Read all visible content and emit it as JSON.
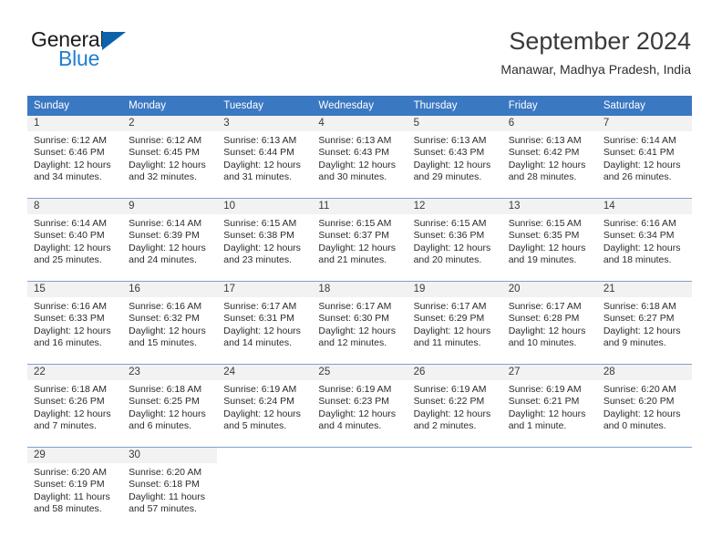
{
  "brand": {
    "name_part1": "General",
    "name_part2": "Blue"
  },
  "header": {
    "title": "September 2024",
    "subtitle": "Manawar, Madhya Pradesh, India"
  },
  "colors": {
    "header_blue": "#3b78c2",
    "brand_blue": "#1f7fd0",
    "triangle_blue": "#0c63ab",
    "daynum_band": "#f2f2f2",
    "row_divider": "#7ba3d0"
  },
  "weekday_headers": [
    "Sunday",
    "Monday",
    "Tuesday",
    "Wednesday",
    "Thursday",
    "Friday",
    "Saturday"
  ],
  "weeks": [
    [
      {
        "day": "1",
        "sunrise": "Sunrise: 6:12 AM",
        "sunset": "Sunset: 6:46 PM",
        "daylight1": "Daylight: 12 hours",
        "daylight2": "and 34 minutes."
      },
      {
        "day": "2",
        "sunrise": "Sunrise: 6:12 AM",
        "sunset": "Sunset: 6:45 PM",
        "daylight1": "Daylight: 12 hours",
        "daylight2": "and 32 minutes."
      },
      {
        "day": "3",
        "sunrise": "Sunrise: 6:13 AM",
        "sunset": "Sunset: 6:44 PM",
        "daylight1": "Daylight: 12 hours",
        "daylight2": "and 31 minutes."
      },
      {
        "day": "4",
        "sunrise": "Sunrise: 6:13 AM",
        "sunset": "Sunset: 6:43 PM",
        "daylight1": "Daylight: 12 hours",
        "daylight2": "and 30 minutes."
      },
      {
        "day": "5",
        "sunrise": "Sunrise: 6:13 AM",
        "sunset": "Sunset: 6:43 PM",
        "daylight1": "Daylight: 12 hours",
        "daylight2": "and 29 minutes."
      },
      {
        "day": "6",
        "sunrise": "Sunrise: 6:13 AM",
        "sunset": "Sunset: 6:42 PM",
        "daylight1": "Daylight: 12 hours",
        "daylight2": "and 28 minutes."
      },
      {
        "day": "7",
        "sunrise": "Sunrise: 6:14 AM",
        "sunset": "Sunset: 6:41 PM",
        "daylight1": "Daylight: 12 hours",
        "daylight2": "and 26 minutes."
      }
    ],
    [
      {
        "day": "8",
        "sunrise": "Sunrise: 6:14 AM",
        "sunset": "Sunset: 6:40 PM",
        "daylight1": "Daylight: 12 hours",
        "daylight2": "and 25 minutes."
      },
      {
        "day": "9",
        "sunrise": "Sunrise: 6:14 AM",
        "sunset": "Sunset: 6:39 PM",
        "daylight1": "Daylight: 12 hours",
        "daylight2": "and 24 minutes."
      },
      {
        "day": "10",
        "sunrise": "Sunrise: 6:15 AM",
        "sunset": "Sunset: 6:38 PM",
        "daylight1": "Daylight: 12 hours",
        "daylight2": "and 23 minutes."
      },
      {
        "day": "11",
        "sunrise": "Sunrise: 6:15 AM",
        "sunset": "Sunset: 6:37 PM",
        "daylight1": "Daylight: 12 hours",
        "daylight2": "and 21 minutes."
      },
      {
        "day": "12",
        "sunrise": "Sunrise: 6:15 AM",
        "sunset": "Sunset: 6:36 PM",
        "daylight1": "Daylight: 12 hours",
        "daylight2": "and 20 minutes."
      },
      {
        "day": "13",
        "sunrise": "Sunrise: 6:15 AM",
        "sunset": "Sunset: 6:35 PM",
        "daylight1": "Daylight: 12 hours",
        "daylight2": "and 19 minutes."
      },
      {
        "day": "14",
        "sunrise": "Sunrise: 6:16 AM",
        "sunset": "Sunset: 6:34 PM",
        "daylight1": "Daylight: 12 hours",
        "daylight2": "and 18 minutes."
      }
    ],
    [
      {
        "day": "15",
        "sunrise": "Sunrise: 6:16 AM",
        "sunset": "Sunset: 6:33 PM",
        "daylight1": "Daylight: 12 hours",
        "daylight2": "and 16 minutes."
      },
      {
        "day": "16",
        "sunrise": "Sunrise: 6:16 AM",
        "sunset": "Sunset: 6:32 PM",
        "daylight1": "Daylight: 12 hours",
        "daylight2": "and 15 minutes."
      },
      {
        "day": "17",
        "sunrise": "Sunrise: 6:17 AM",
        "sunset": "Sunset: 6:31 PM",
        "daylight1": "Daylight: 12 hours",
        "daylight2": "and 14 minutes."
      },
      {
        "day": "18",
        "sunrise": "Sunrise: 6:17 AM",
        "sunset": "Sunset: 6:30 PM",
        "daylight1": "Daylight: 12 hours",
        "daylight2": "and 12 minutes."
      },
      {
        "day": "19",
        "sunrise": "Sunrise: 6:17 AM",
        "sunset": "Sunset: 6:29 PM",
        "daylight1": "Daylight: 12 hours",
        "daylight2": "and 11 minutes."
      },
      {
        "day": "20",
        "sunrise": "Sunrise: 6:17 AM",
        "sunset": "Sunset: 6:28 PM",
        "daylight1": "Daylight: 12 hours",
        "daylight2": "and 10 minutes."
      },
      {
        "day": "21",
        "sunrise": "Sunrise: 6:18 AM",
        "sunset": "Sunset: 6:27 PM",
        "daylight1": "Daylight: 12 hours",
        "daylight2": "and 9 minutes."
      }
    ],
    [
      {
        "day": "22",
        "sunrise": "Sunrise: 6:18 AM",
        "sunset": "Sunset: 6:26 PM",
        "daylight1": "Daylight: 12 hours",
        "daylight2": "and 7 minutes."
      },
      {
        "day": "23",
        "sunrise": "Sunrise: 6:18 AM",
        "sunset": "Sunset: 6:25 PM",
        "daylight1": "Daylight: 12 hours",
        "daylight2": "and 6 minutes."
      },
      {
        "day": "24",
        "sunrise": "Sunrise: 6:19 AM",
        "sunset": "Sunset: 6:24 PM",
        "daylight1": "Daylight: 12 hours",
        "daylight2": "and 5 minutes."
      },
      {
        "day": "25",
        "sunrise": "Sunrise: 6:19 AM",
        "sunset": "Sunset: 6:23 PM",
        "daylight1": "Daylight: 12 hours",
        "daylight2": "and 4 minutes."
      },
      {
        "day": "26",
        "sunrise": "Sunrise: 6:19 AM",
        "sunset": "Sunset: 6:22 PM",
        "daylight1": "Daylight: 12 hours",
        "daylight2": "and 2 minutes."
      },
      {
        "day": "27",
        "sunrise": "Sunrise: 6:19 AM",
        "sunset": "Sunset: 6:21 PM",
        "daylight1": "Daylight: 12 hours",
        "daylight2": "and 1 minute."
      },
      {
        "day": "28",
        "sunrise": "Sunrise: 6:20 AM",
        "sunset": "Sunset: 6:20 PM",
        "daylight1": "Daylight: 12 hours",
        "daylight2": "and 0 minutes."
      }
    ],
    [
      {
        "day": "29",
        "sunrise": "Sunrise: 6:20 AM",
        "sunset": "Sunset: 6:19 PM",
        "daylight1": "Daylight: 11 hours",
        "daylight2": "and 58 minutes."
      },
      {
        "day": "30",
        "sunrise": "Sunrise: 6:20 AM",
        "sunset": "Sunset: 6:18 PM",
        "daylight1": "Daylight: 11 hours",
        "daylight2": "and 57 minutes."
      },
      {
        "day": "",
        "sunrise": "",
        "sunset": "",
        "daylight1": "",
        "daylight2": ""
      },
      {
        "day": "",
        "sunrise": "",
        "sunset": "",
        "daylight1": "",
        "daylight2": ""
      },
      {
        "day": "",
        "sunrise": "",
        "sunset": "",
        "daylight1": "",
        "daylight2": ""
      },
      {
        "day": "",
        "sunrise": "",
        "sunset": "",
        "daylight1": "",
        "daylight2": ""
      },
      {
        "day": "",
        "sunrise": "",
        "sunset": "",
        "daylight1": "",
        "daylight2": ""
      }
    ]
  ]
}
